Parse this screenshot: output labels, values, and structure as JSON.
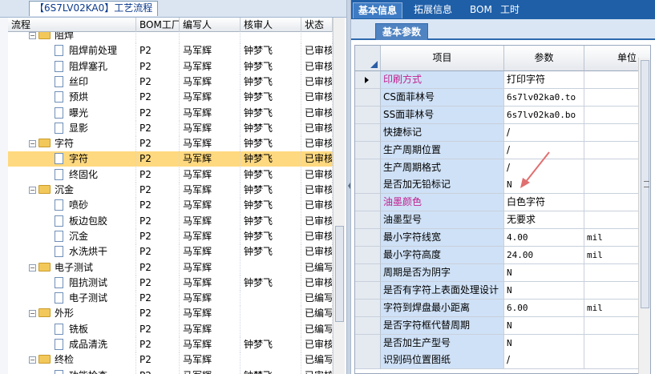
{
  "left_panel": {
    "title": "【6S7LV02KA0】工艺流程",
    "columns": [
      "流程",
      "BOM工厂",
      "编写人",
      "核审人",
      "状态"
    ],
    "rows": [
      {
        "name": "阻焊",
        "type": "folder",
        "level": 0,
        "bom": "",
        "author": "",
        "reviewer": "",
        "status": ""
      },
      {
        "name": "阻焊前处理",
        "type": "item",
        "level": 1,
        "bom": "P2",
        "author": "马军辉",
        "reviewer": "钟梦飞",
        "status": "已审核"
      },
      {
        "name": "阻焊塞孔",
        "type": "item",
        "level": 1,
        "bom": "P2",
        "author": "马军辉",
        "reviewer": "钟梦飞",
        "status": "已审核"
      },
      {
        "name": "丝印",
        "type": "item",
        "level": 1,
        "bom": "P2",
        "author": "马军辉",
        "reviewer": "钟梦飞",
        "status": "已审核"
      },
      {
        "name": "预烘",
        "type": "item",
        "level": 1,
        "bom": "P2",
        "author": "马军辉",
        "reviewer": "钟梦飞",
        "status": "已审核"
      },
      {
        "name": "曝光",
        "type": "item",
        "level": 1,
        "bom": "P2",
        "author": "马军辉",
        "reviewer": "钟梦飞",
        "status": "已审核"
      },
      {
        "name": "显影",
        "type": "item",
        "level": 1,
        "bom": "P2",
        "author": "马军辉",
        "reviewer": "钟梦飞",
        "status": "已审核"
      },
      {
        "name": "字符",
        "type": "folder",
        "level": 0,
        "bom": "P2",
        "author": "马军辉",
        "reviewer": "钟梦飞",
        "status": "已审核"
      },
      {
        "name": "字符",
        "type": "item",
        "level": 1,
        "bom": "P2",
        "author": "马军辉",
        "reviewer": "钟梦飞",
        "status": "已审核",
        "selected": true
      },
      {
        "name": "终固化",
        "type": "item",
        "level": 1,
        "bom": "P2",
        "author": "马军辉",
        "reviewer": "钟梦飞",
        "status": "已审核"
      },
      {
        "name": "沉金",
        "type": "folder",
        "level": 0,
        "bom": "P2",
        "author": "马军辉",
        "reviewer": "钟梦飞",
        "status": "已审核"
      },
      {
        "name": "喷砂",
        "type": "item",
        "level": 1,
        "bom": "P2",
        "author": "马军辉",
        "reviewer": "钟梦飞",
        "status": "已审核"
      },
      {
        "name": "板边包胶",
        "type": "item",
        "level": 1,
        "bom": "P2",
        "author": "马军辉",
        "reviewer": "钟梦飞",
        "status": "已审核"
      },
      {
        "name": "沉金",
        "type": "item",
        "level": 1,
        "bom": "P2",
        "author": "马军辉",
        "reviewer": "钟梦飞",
        "status": "已审核"
      },
      {
        "name": "水洗烘干",
        "type": "item",
        "level": 1,
        "bom": "P2",
        "author": "马军辉",
        "reviewer": "钟梦飞",
        "status": "已审核"
      },
      {
        "name": "电子测试",
        "type": "folder",
        "level": 0,
        "bom": "P2",
        "author": "马军辉",
        "reviewer": "",
        "status": "已编写"
      },
      {
        "name": "阻抗测试",
        "type": "item",
        "level": 1,
        "bom": "P2",
        "author": "马军辉",
        "reviewer": "钟梦飞",
        "status": "已审核"
      },
      {
        "name": "电子测试",
        "type": "item",
        "level": 1,
        "bom": "P2",
        "author": "马军辉",
        "reviewer": "",
        "status": "已编写"
      },
      {
        "name": "外形",
        "type": "folder",
        "level": 0,
        "bom": "P2",
        "author": "马军辉",
        "reviewer": "",
        "status": "已编写"
      },
      {
        "name": "铣板",
        "type": "item",
        "level": 1,
        "bom": "P2",
        "author": "马军辉",
        "reviewer": "",
        "status": "已编写"
      },
      {
        "name": "成品清洗",
        "type": "item",
        "level": 1,
        "bom": "P2",
        "author": "马军辉",
        "reviewer": "钟梦飞",
        "status": "已审核"
      },
      {
        "name": "终检",
        "type": "folder",
        "level": 0,
        "bom": "P2",
        "author": "马军辉",
        "reviewer": "",
        "status": "已编写"
      },
      {
        "name": "功能检查",
        "type": "item",
        "level": 1,
        "bom": "P2",
        "author": "马军辉",
        "reviewer": "钟梦飞",
        "status": "已审核"
      }
    ]
  },
  "right_panel": {
    "tabs": [
      "基本信息",
      "拓展信息",
      "BOM",
      "工时"
    ],
    "active_tab": "基本信息",
    "sub_tab": "基本参数",
    "grid_columns": [
      "项目",
      "参数",
      "单位"
    ],
    "rows": [
      {
        "label": "印刷方式",
        "value": "打印字符",
        "unit": "",
        "pink": true,
        "current": true
      },
      {
        "label": "CS面菲林号",
        "value": "6s7lv02ka0.to",
        "unit": "",
        "mono": true
      },
      {
        "label": "SS面菲林号",
        "value": "6s7lv02ka0.bo",
        "unit": "",
        "mono": true
      },
      {
        "label": "快捷标记",
        "value": "/",
        "unit": ""
      },
      {
        "label": "生产周期位置",
        "value": "/",
        "unit": ""
      },
      {
        "label": "生产周期格式",
        "value": "/",
        "unit": ""
      },
      {
        "label": "是否加无铅标记",
        "value": "N",
        "unit": "",
        "mono": true
      },
      {
        "label": "油墨颜色",
        "value": "白色字符",
        "unit": "",
        "pink": true
      },
      {
        "label": "油墨型号",
        "value": "无要求",
        "unit": ""
      },
      {
        "label": "最小字符线宽",
        "value": "4.00",
        "unit": "mil",
        "mono": true
      },
      {
        "label": "最小字符高度",
        "value": "24.00",
        "unit": "mil",
        "mono": true
      },
      {
        "label": "周期是否为阴字",
        "value": "N",
        "unit": "",
        "mono": true
      },
      {
        "label": "是否有字符上表面处理设计",
        "value": "N",
        "unit": "",
        "mono": true
      },
      {
        "label": "字符到焊盘最小距离",
        "value": "6.00",
        "unit": "mil",
        "mono": true
      },
      {
        "label": "是否字符框代替周期",
        "value": "N",
        "unit": "",
        "mono": true
      },
      {
        "label": "是否加生产型号",
        "value": "N",
        "unit": "",
        "mono": true
      },
      {
        "label": "识别码位置图纸",
        "value": "/",
        "unit": ""
      }
    ]
  },
  "colors": {
    "tab_bar": "#1f5fa8",
    "selected_row": "#ffd97f",
    "label_cell": "#cfe1f6",
    "pink_text": "#c0208f",
    "annotation_arrow": "#e07070"
  }
}
